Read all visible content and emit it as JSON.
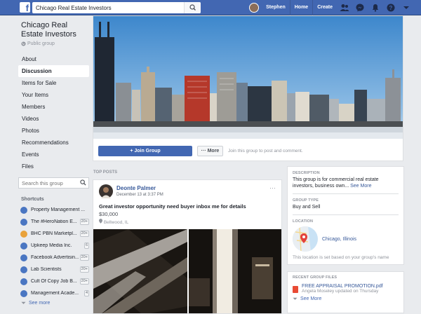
{
  "topbar": {
    "logo": "f",
    "search_value": "Chicago Real Estate Investors",
    "user_name": "Stephen",
    "home_label": "Home",
    "create_label": "Create"
  },
  "group": {
    "title": "Chicago Real Estate Investors",
    "type": "Public group"
  },
  "left_nav": [
    {
      "label": "About"
    },
    {
      "label": "Discussion",
      "active": true
    },
    {
      "label": "Items for Sale"
    },
    {
      "label": "Your Items"
    },
    {
      "label": "Members"
    },
    {
      "label": "Videos"
    },
    {
      "label": "Photos"
    },
    {
      "label": "Recommendations"
    },
    {
      "label": "Events"
    },
    {
      "label": "Files"
    }
  ],
  "left_search": {
    "placeholder": "Search this group"
  },
  "shortcuts": {
    "heading": "Shortcuts",
    "items": [
      {
        "label": "Property Management ...",
        "badge": ""
      },
      {
        "label": "The #HeroNation E...",
        "badge": "20+"
      },
      {
        "label": "BHC PBN Marketpl...",
        "badge": "20+"
      },
      {
        "label": "Upkeep Media Inc.",
        "badge": "6"
      },
      {
        "label": "Facebook Advertisin...",
        "badge": "20+"
      },
      {
        "label": "Lab Scientists",
        "badge": "20+"
      },
      {
        "label": "Cult Of Copy Job B...",
        "badge": "20+"
      },
      {
        "label": "Management Acade...",
        "badge": "4"
      }
    ],
    "see_more": "See more"
  },
  "cover": {
    "join_label": "+ Join Group",
    "more_label": "··· More",
    "join_text": "Join this group to post and comment."
  },
  "feed": {
    "section_label": "TOP POSTS",
    "post": {
      "author": "Deonte Palmer",
      "date": "December 13 at 3:37 PM",
      "title": "Great investor opportunity need buyer inbox me for details",
      "price": "$30,000",
      "location": "Bellwood, IL"
    }
  },
  "about": {
    "description_heading": "DESCRIPTION",
    "description_text": "This group is for commercial real estate investors, business own...",
    "see_more": "See More",
    "group_type_heading": "GROUP TYPE",
    "group_type": "Buy and Sell",
    "location_heading": "LOCATION",
    "location": "Chicago, Illinois",
    "location_note": "This location is set based on your group's name"
  },
  "files": {
    "heading": "RECENT GROUP FILES",
    "file_name": "FREE APPRAISAL PROMOTION.pdf",
    "file_meta": "Angela Moseley updated on Thursday",
    "see_more": "See More"
  },
  "colors": {
    "brand_blue": "#4267b2",
    "link_blue": "#365899",
    "page_bg": "#e9ebee",
    "pdf_red": "#e94b35"
  }
}
